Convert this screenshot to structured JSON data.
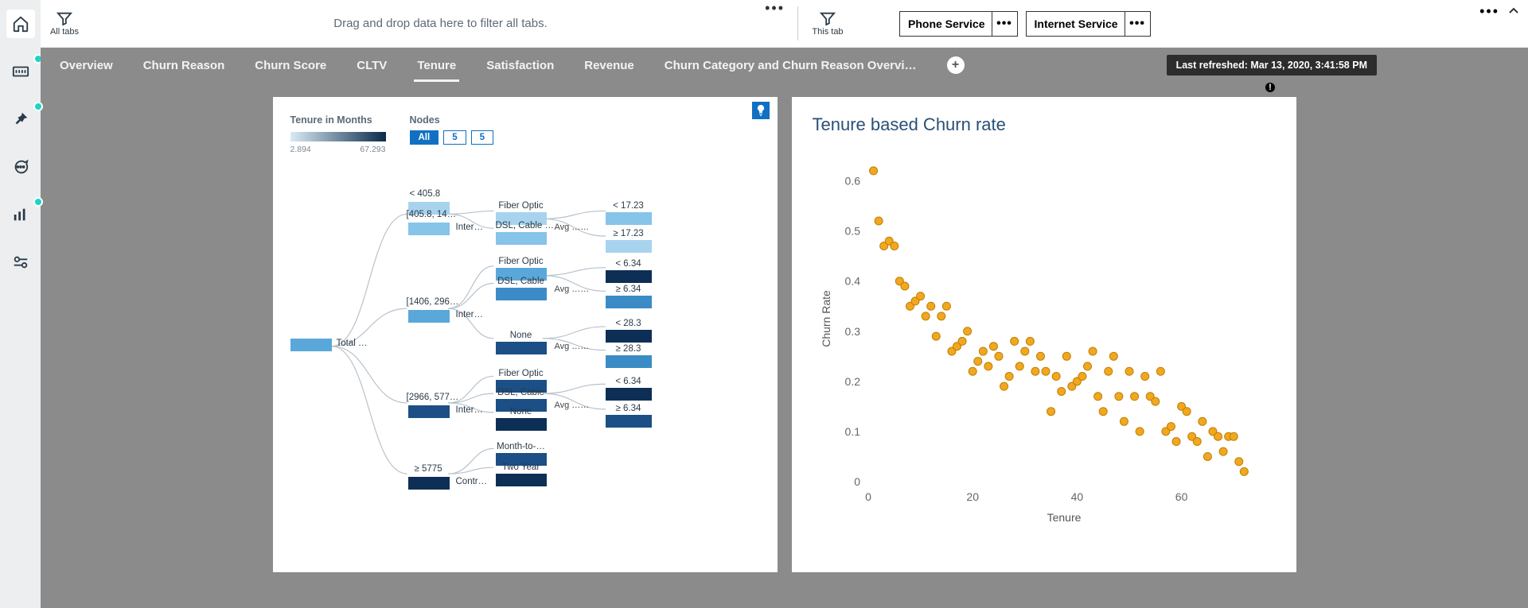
{
  "rail": [
    {
      "name": "home-icon",
      "dot": false,
      "active": true
    },
    {
      "name": "data-icon",
      "dot": true,
      "active": false
    },
    {
      "name": "pin-icon",
      "dot": true,
      "active": false
    },
    {
      "name": "chat-icon",
      "dot": false,
      "active": false
    },
    {
      "name": "chart-icon",
      "dot": true,
      "active": false
    },
    {
      "name": "settings-icon",
      "dot": false,
      "active": false
    }
  ],
  "filters": {
    "allTabsLabel": "All tabs",
    "thisTabLabel": "This tab",
    "dropMessage": "Drag and drop data here to filter all tabs.",
    "chips": [
      {
        "label": "Phone Service"
      },
      {
        "label": "Internet Service"
      }
    ]
  },
  "refreshed": "Last refreshed: Mar 13, 2020, 3:41:58 PM",
  "tabs": [
    {
      "label": "Overview",
      "active": false
    },
    {
      "label": "Churn Reason",
      "active": false
    },
    {
      "label": "Churn Score",
      "active": false
    },
    {
      "label": "CLTV",
      "active": false
    },
    {
      "label": "Tenure",
      "active": true
    },
    {
      "label": "Satisfaction",
      "active": false
    },
    {
      "label": "Revenue",
      "active": false
    },
    {
      "label": "Churn Category and Churn Reason Overvi…",
      "active": false
    }
  ],
  "tree": {
    "legendTitle": "Tenure in Months",
    "legendMin": "2.894",
    "legendMax": "67.293",
    "nodesTitle": "Nodes",
    "nodeBtns": [
      "All",
      "5",
      "5"
    ],
    "root": "Total …",
    "branches": [
      {
        "thr": "< 405.8",
        "split": "",
        "kids": []
      },
      {
        "thr": "[405.8, 14…",
        "split": "Inter…",
        "kids": [
          "Fiber Optic",
          "DSL, Cable …"
        ],
        "avg": "Avg ……",
        "leaves": [
          "< 17.23",
          "≥ 17.23"
        ]
      },
      {
        "thr": "[1406, 296…",
        "split": "Inter…",
        "kids": [
          "Fiber Optic",
          "DSL, Cable"
        ],
        "avg": "Avg ……",
        "leaves": [
          "< 6.34",
          "≥ 6.34"
        ],
        "extra": {
          "kid": "None",
          "leaves": [
            "< 28.3",
            "≥ 28.3"
          ],
          "avg": "Avg ……"
        }
      },
      {
        "thr": "[2966, 577…",
        "split": "Inter…",
        "kids": [
          "Fiber Optic",
          "DSL, Cable",
          "None"
        ],
        "avg": "Avg ……",
        "leaves": [
          "< 6.34",
          "≥ 6.34"
        ]
      },
      {
        "thr": "≥ 5775",
        "split": "Contr…",
        "kids": [
          "Month-to-…",
          "Two Year"
        ],
        "avg": "",
        "leaves": []
      }
    ]
  },
  "scatter": {
    "title": "Tenure based Churn rate",
    "xlabel": "Tenure",
    "ylabel": "Churn Rate"
  },
  "chart_data": {
    "type": "scatter",
    "title": "Tenure based Churn rate",
    "xlabel": "Tenure",
    "ylabel": "Churn Rate",
    "xlim": [
      0,
      75
    ],
    "ylim": [
      0,
      0.65
    ],
    "xticks": [
      0,
      20,
      40,
      60
    ],
    "yticks": [
      0,
      0.1,
      0.2,
      0.3,
      0.4,
      0.5,
      0.6
    ],
    "series": [
      {
        "name": "Churn Rate",
        "points": [
          [
            1,
            0.62
          ],
          [
            2,
            0.52
          ],
          [
            3,
            0.47
          ],
          [
            4,
            0.48
          ],
          [
            5,
            0.47
          ],
          [
            6,
            0.4
          ],
          [
            7,
            0.39
          ],
          [
            8,
            0.35
          ],
          [
            9,
            0.36
          ],
          [
            10,
            0.37
          ],
          [
            11,
            0.33
          ],
          [
            12,
            0.35
          ],
          [
            13,
            0.29
          ],
          [
            14,
            0.33
          ],
          [
            15,
            0.35
          ],
          [
            16,
            0.26
          ],
          [
            17,
            0.27
          ],
          [
            18,
            0.28
          ],
          [
            19,
            0.3
          ],
          [
            20,
            0.22
          ],
          [
            21,
            0.24
          ],
          [
            22,
            0.26
          ],
          [
            23,
            0.23
          ],
          [
            24,
            0.27
          ],
          [
            25,
            0.25
          ],
          [
            26,
            0.19
          ],
          [
            27,
            0.21
          ],
          [
            28,
            0.28
          ],
          [
            29,
            0.23
          ],
          [
            30,
            0.26
          ],
          [
            31,
            0.28
          ],
          [
            32,
            0.22
          ],
          [
            33,
            0.25
          ],
          [
            34,
            0.22
          ],
          [
            35,
            0.14
          ],
          [
            36,
            0.21
          ],
          [
            37,
            0.18
          ],
          [
            38,
            0.25
          ],
          [
            39,
            0.19
          ],
          [
            40,
            0.2
          ],
          [
            41,
            0.21
          ],
          [
            42,
            0.23
          ],
          [
            43,
            0.26
          ],
          [
            44,
            0.17
          ],
          [
            45,
            0.14
          ],
          [
            46,
            0.22
          ],
          [
            47,
            0.25
          ],
          [
            48,
            0.17
          ],
          [
            49,
            0.12
          ],
          [
            50,
            0.22
          ],
          [
            51,
            0.17
          ],
          [
            52,
            0.1
          ],
          [
            53,
            0.21
          ],
          [
            54,
            0.17
          ],
          [
            55,
            0.16
          ],
          [
            56,
            0.22
          ],
          [
            57,
            0.1
          ],
          [
            58,
            0.11
          ],
          [
            59,
            0.08
          ],
          [
            60,
            0.15
          ],
          [
            61,
            0.14
          ],
          [
            62,
            0.09
          ],
          [
            63,
            0.08
          ],
          [
            64,
            0.12
          ],
          [
            65,
            0.05
          ],
          [
            66,
            0.1
          ],
          [
            67,
            0.09
          ],
          [
            68,
            0.06
          ],
          [
            69,
            0.09
          ],
          [
            70,
            0.09
          ],
          [
            71,
            0.04
          ],
          [
            72,
            0.02
          ]
        ]
      }
    ]
  }
}
